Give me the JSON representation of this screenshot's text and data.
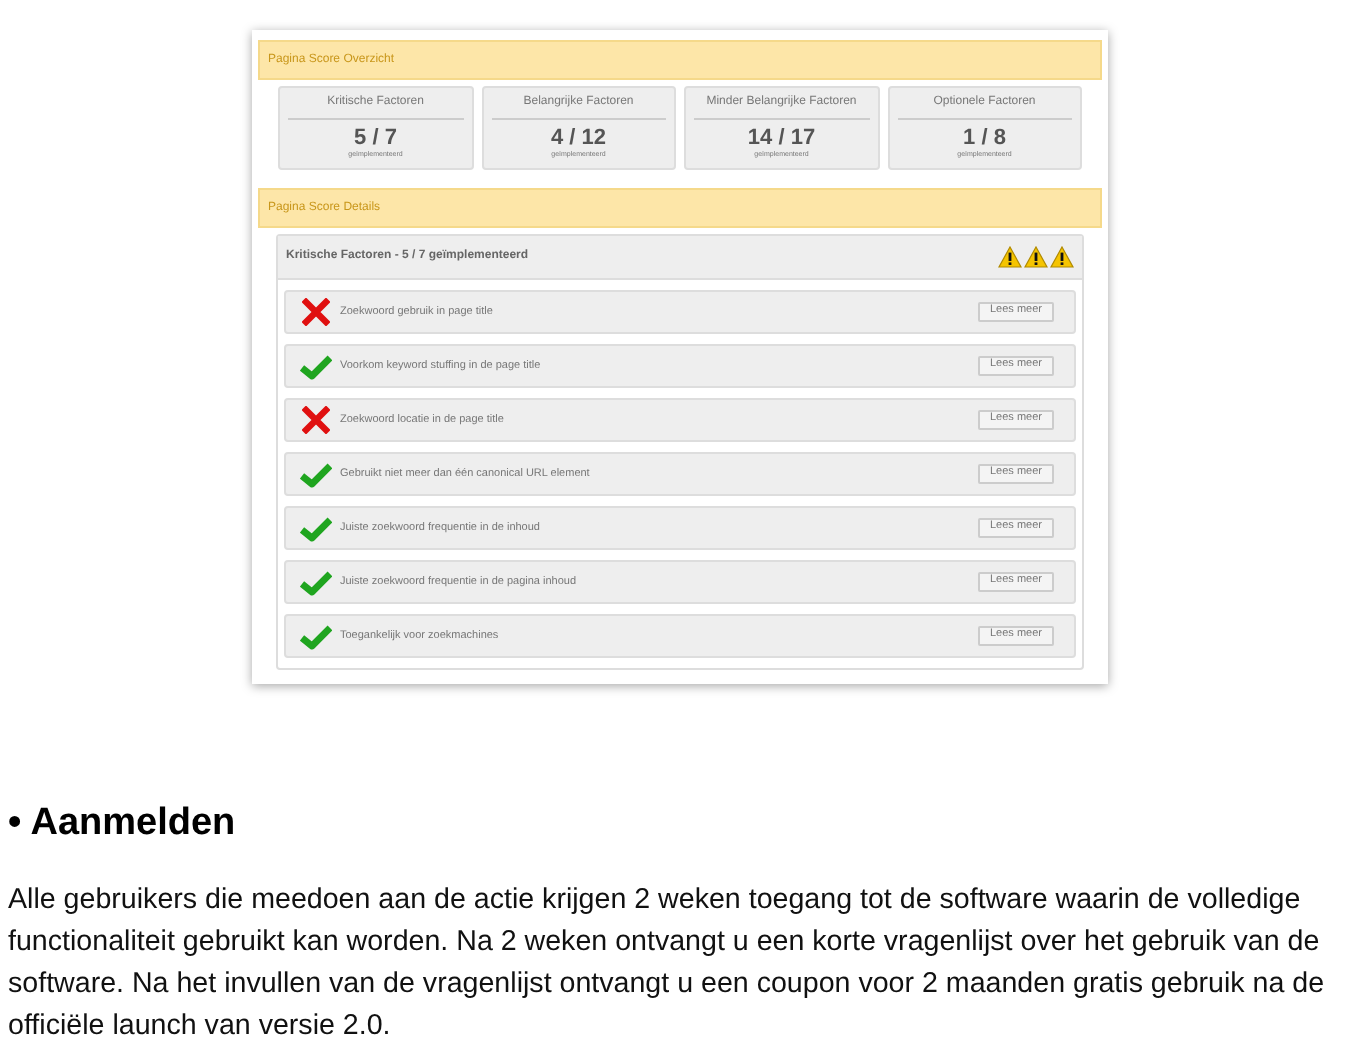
{
  "overview": {
    "title": "Pagina Score Overzicht",
    "cards": [
      {
        "title": "Kritische Factoren",
        "score": "5 / 7",
        "caption": "geïmplementeerd"
      },
      {
        "title": "Belangrijke Factoren",
        "score": "4 / 12",
        "caption": "geïmplementeerd"
      },
      {
        "title": "Minder Belangrijke Factoren",
        "score": "14 / 17",
        "caption": "geïmplementeerd"
      },
      {
        "title": "Optionele Factoren",
        "score": "1 / 8",
        "caption": "geïmplementeerd"
      }
    ]
  },
  "details": {
    "title": "Pagina Score Details",
    "section": {
      "title": "Kritische Factoren - 5 / 7 geïmplementeerd",
      "indicators": [
        {
          "kind": "warning"
        },
        {
          "kind": "warning"
        },
        {
          "kind": "warning"
        }
      ],
      "items": [
        {
          "label": "Zoekwoord gebruik in page title",
          "passed": false,
          "button": "Lees meer"
        },
        {
          "label": "Voorkom keyword stuffing in de page title",
          "passed": true,
          "button": "Lees meer"
        },
        {
          "label": "Zoekwoord locatie in de page title",
          "passed": false,
          "button": "Lees meer"
        },
        {
          "label": "Gebruikt niet meer dan één canonical URL element",
          "passed": true,
          "button": "Lees meer"
        },
        {
          "label": "Juiste zoekwoord frequentie in de inhoud",
          "passed": true,
          "button": "Lees meer"
        },
        {
          "label": "Juiste zoekwoord frequentie in de pagina inhoud",
          "passed": true,
          "button": "Lees meer"
        },
        {
          "label": "Toegankelijk voor zoekmachines",
          "passed": true,
          "button": "Lees meer"
        }
      ]
    }
  },
  "article": {
    "heading": "• Aanmelden",
    "paragraph": "Alle gebruikers die meedoen aan de actie krijgen 2 weken toegang tot de software waarin de volledige functionaliteit gebruikt kan worden. Na 2 weken ontvangt u een korte vragenlijst over het gebruik van de software. Na het invullen van de vragenlijst ontvangt u een coupon voor 2 maanden gratis gebruik na de officiële launch van versie 2.0."
  }
}
